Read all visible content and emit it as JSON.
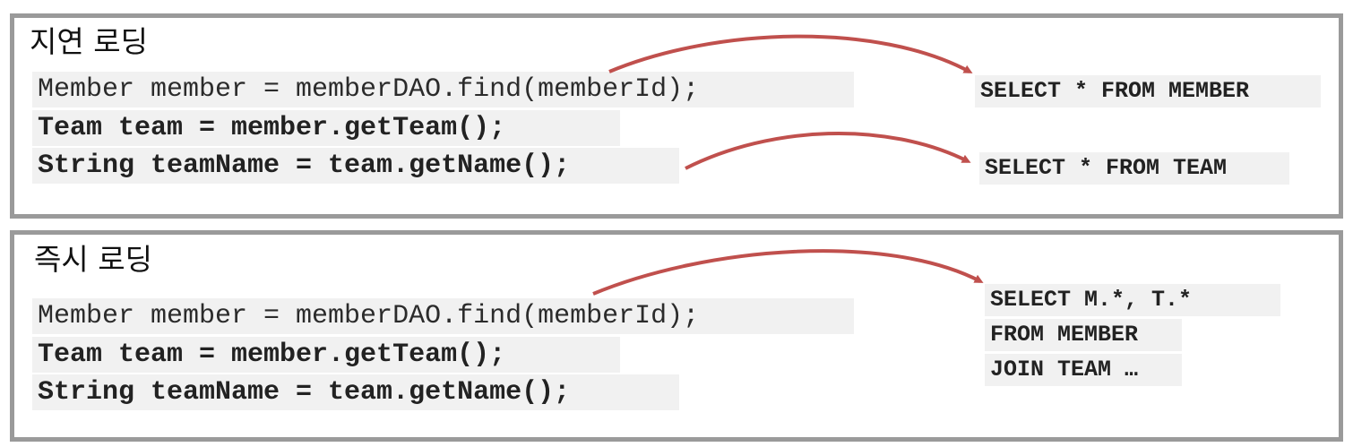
{
  "lazy": {
    "title": "지연 로딩",
    "code": [
      "Member member = memberDAO.find(memberId);",
      "Team team = member.getTeam();",
      "String teamName = team.getName();"
    ],
    "sql": [
      "SELECT * FROM MEMBER",
      "SELECT * FROM TEAM"
    ]
  },
  "eager": {
    "title": "즉시 로딩",
    "code": [
      "Member member = memberDAO.find(memberId);",
      "Team team = member.getTeam();",
      "String teamName = team.getName();"
    ],
    "sql": [
      "SELECT M.*, T.*",
      "FROM MEMBER",
      "JOIN TEAM …"
    ]
  },
  "colors": {
    "arrow": "#c0504d",
    "border": "#9a9a9a",
    "code_bg": "#f1f1f1"
  }
}
